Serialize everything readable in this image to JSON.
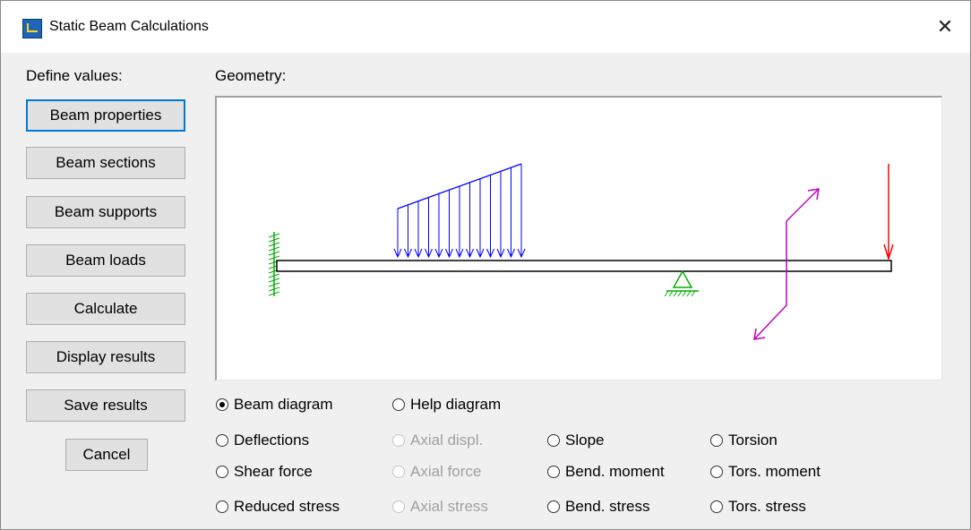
{
  "window": {
    "title": "Static Beam Calculations",
    "close_symbol": "✕"
  },
  "left_panel": {
    "heading": "Define values:",
    "buttons": [
      {
        "label": "Beam properties"
      },
      {
        "label": "Beam sections"
      },
      {
        "label": "Beam supports"
      },
      {
        "label": "Beam loads"
      },
      {
        "label": "Calculate"
      },
      {
        "label": "Display results"
      },
      {
        "label": "Save results"
      }
    ],
    "cancel_label": "Cancel"
  },
  "geometry": {
    "heading": "Geometry:",
    "colors": {
      "beam": "#000000",
      "fixed_support": "#00b000",
      "pin_support": "#00b000",
      "distributed_load": "#0000ff",
      "point_load": "#ff0000",
      "moment": "#c000c0"
    }
  },
  "options": {
    "row1": [
      {
        "label": "Beam diagram",
        "checked": true,
        "enabled": true
      },
      {
        "label": "Help diagram",
        "checked": false,
        "enabled": true
      }
    ],
    "grid": [
      [
        {
          "label": "Deflections",
          "enabled": true
        },
        {
          "label": "Axial displ.",
          "enabled": false
        },
        {
          "label": "Slope",
          "enabled": true
        },
        {
          "label": "Torsion",
          "enabled": true
        }
      ],
      [
        {
          "label": "Shear force",
          "enabled": true
        },
        {
          "label": "Axial force",
          "enabled": false
        },
        {
          "label": "Bend. moment",
          "enabled": true
        },
        {
          "label": "Tors. moment",
          "enabled": true
        }
      ],
      [
        {
          "label": "Reduced stress",
          "enabled": true
        },
        {
          "label": "Axial stress",
          "enabled": false
        },
        {
          "label": "Bend. stress",
          "enabled": true
        },
        {
          "label": "Tors. stress",
          "enabled": true
        }
      ]
    ]
  }
}
